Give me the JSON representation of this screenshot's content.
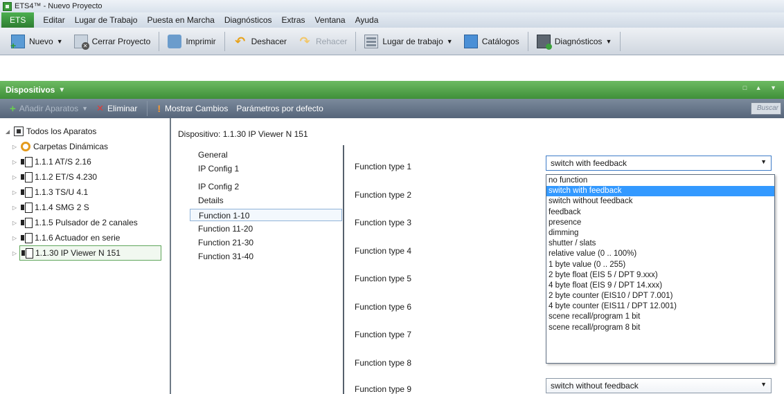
{
  "window": {
    "title": "ETS4™ - Nuevo Proyecto"
  },
  "menubar": {
    "app": "ETS",
    "items": [
      "Editar",
      "Lugar de Trabajo",
      "Puesta en Marcha",
      "Diagnósticos",
      "Extras",
      "Ventana",
      "Ayuda"
    ]
  },
  "toolbar": {
    "new": "Nuevo",
    "close_project": "Cerrar Proyecto",
    "print": "Imprimir",
    "undo": "Deshacer",
    "redo": "Rehacer",
    "workspace": "Lugar de trabajo",
    "catalogs": "Catálogos",
    "diagnostics": "Diagnósticos"
  },
  "panel": {
    "title": "Dispositivos"
  },
  "toolbar2": {
    "add_devices": "Añadir Aparatos",
    "delete": "Eliminar",
    "show_changes": "Mostrar Cambios",
    "default_params": "Parámetros por defecto",
    "search_placeholder": "Buscar"
  },
  "tree": {
    "root": "Todos los Aparatos",
    "dynamic": "Carpetas Dinámicas",
    "devices": [
      "1.1.1 AT/S 2.16",
      "1.1.2 ET/S 4.230",
      "1.1.3 TS/U 4.1",
      "1.1.4 SMG 2 S",
      "1.1.5 Pulsador de 2 canales",
      "1.1.6 Actuador en serie",
      "1.1.30 IP Viewer N 151"
    ]
  },
  "device": {
    "title": "Dispositivo: 1.1.30  IP Viewer N 151",
    "nav": [
      "General",
      "IP Config 1",
      "IP Config 2",
      "Details",
      "Function 1-10",
      "Function 11-20",
      "Function 21-30",
      "Function 31-40"
    ],
    "selected_nav": "Function 1-10"
  },
  "params": [
    {
      "label": "Function type 1",
      "value": "switch with feedback"
    },
    {
      "label": "Function type 2",
      "value": ""
    },
    {
      "label": "Function type 3",
      "value": ""
    },
    {
      "label": "Function type 4",
      "value": ""
    },
    {
      "label": "Function type 5",
      "value": ""
    },
    {
      "label": "Function type 6",
      "value": ""
    },
    {
      "label": "Function type 7",
      "value": ""
    },
    {
      "label": "Function type 8",
      "value": ""
    },
    {
      "label": "Function type 9",
      "value": "switch without feedback"
    }
  ],
  "dropdown": {
    "selected": "switch with feedback",
    "options": [
      "no function",
      "switch with feedback",
      "switch without feedback",
      "feedback",
      "presence",
      "dimming",
      "shutter / slats",
      "relative value (0 .. 100%)",
      "1 byte value (0 .. 255)",
      "2 byte float (EIS 5 / DPT 9.xxx)",
      "4 byte float (EIS 9 / DPT 14.xxx)",
      "2 byte counter (EIS10 / DPT 7.001)",
      "4 byte counter (EIS11 / DPT 12.001)",
      "scene recall/program 1 bit",
      "scene recall/program 8 bit"
    ]
  }
}
